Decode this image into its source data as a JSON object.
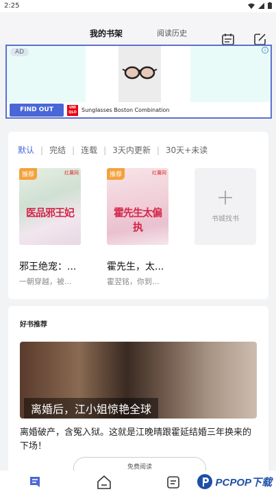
{
  "status_bar": {
    "time": "2:25"
  },
  "header": {
    "tabs": [
      {
        "label": "我的书架",
        "active": true
      },
      {
        "label": "阅读历史",
        "active": false
      }
    ]
  },
  "ad": {
    "badge": "AD",
    "cta": "FIND OUT MORE",
    "brand_logo": "UNI QLO",
    "text": "Sunglasses Boston Combination"
  },
  "shelf": {
    "filters": [
      "默认",
      "完结",
      "连载",
      "3天内更新",
      "30天+未读"
    ],
    "active_filter": "默认",
    "books": [
      {
        "tag": "推荐",
        "publisher": "红薯网",
        "cover_text": "医品邪王妃",
        "title": "邪王绝宠：...",
        "desc": "一朝穿越，被..."
      },
      {
        "tag": "推荐",
        "publisher": "红薯网",
        "cover_text": "霍先生太偏执",
        "title": "霍先生，太...",
        "desc": "霍翌铭，你到..."
      }
    ],
    "find_books_label": "书城找书"
  },
  "recommend": {
    "heading": "好书推荐",
    "banner_caption": "离婚后，江小姐惊艳全球",
    "description": "离婚破产，含冤入狱。这就是江晚晴跟霍延结婚三年换来的下场！",
    "read_button": "免费阅读"
  },
  "watermark": {
    "text": "PCPOP下载"
  },
  "colors": {
    "accent": "#4a67d8",
    "tag": "#f5a13b"
  }
}
